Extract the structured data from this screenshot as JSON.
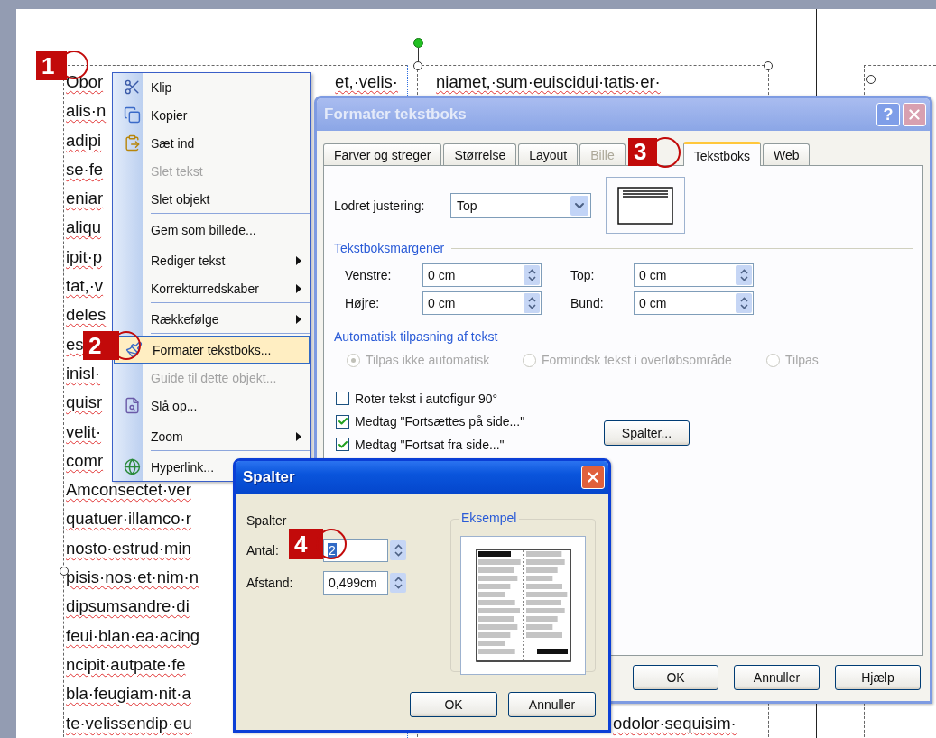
{
  "document": {
    "left_lines": [
      "Obor",
      "alis·n",
      "adipi",
      "se·fe",
      "eniar",
      "aliqu",
      "ipit·p",
      "tat,·v",
      "deles",
      "es",
      "inisl·",
      "quisr",
      "velit·",
      "comr",
      "Amconsectet·ver",
      "quatuer·illamco·r",
      "nosto·estrud·min",
      "pisis·nos·et·nim·n",
      "dipsumsandre·di",
      "feui·blan·ea·acing",
      "ncipit·autpate·fe",
      "bla·feugiam·nit·a",
      "te·velissendip·eu"
    ],
    "first_line_end": "et,·velis·",
    "right_first_line": "niamet,·sum·euiscidui·tatis·er·",
    "right_last_line": "odolor·sequisim·"
  },
  "context_menu": {
    "items": [
      {
        "kind": "command",
        "label": "Klip",
        "selected": false,
        "disabled": false
      },
      {
        "kind": "command",
        "label": "Kopier",
        "selected": false,
        "disabled": false
      },
      {
        "kind": "command",
        "label": "Sæt ind",
        "selected": false,
        "disabled": false
      },
      {
        "kind": "command",
        "label": "Slet tekst",
        "selected": false,
        "disabled": true
      },
      {
        "kind": "command",
        "label": "Slet objekt",
        "selected": false,
        "disabled": false
      },
      {
        "kind": "separator"
      },
      {
        "kind": "command",
        "label": "Gem som billede...",
        "selected": false,
        "disabled": false
      },
      {
        "kind": "separator"
      },
      {
        "kind": "submenu",
        "label": "Rediger tekst",
        "selected": false,
        "disabled": false
      },
      {
        "kind": "submenu",
        "label": "Korrekturredskaber",
        "selected": false,
        "disabled": false
      },
      {
        "kind": "separator"
      },
      {
        "kind": "submenu",
        "label": "Rækkefølge",
        "selected": false,
        "disabled": false
      },
      {
        "kind": "separator"
      },
      {
        "kind": "command",
        "label": "Formater tekstboks...",
        "selected": true,
        "disabled": false
      },
      {
        "kind": "command",
        "label": "Guide til dette objekt...",
        "selected": false,
        "disabled": true
      },
      {
        "kind": "command",
        "label": "Slå op...",
        "selected": false,
        "disabled": false
      },
      {
        "kind": "separator"
      },
      {
        "kind": "submenu",
        "label": "Zoom",
        "selected": false,
        "disabled": false
      },
      {
        "kind": "separator"
      },
      {
        "kind": "command",
        "label": "Hyperlink...",
        "selected": false,
        "disabled": false
      }
    ]
  },
  "format_dialog": {
    "title": "Formater tekstboks",
    "help_button": "?",
    "tabs": [
      {
        "label": "Farver og streger",
        "selected": false,
        "disabled": false
      },
      {
        "label": "Størrelse",
        "selected": false,
        "disabled": false
      },
      {
        "label": "Layout",
        "selected": false,
        "disabled": false
      },
      {
        "label": "Bille",
        "selected": false,
        "disabled": true
      },
      {
        "label": "Tekstboks",
        "selected": true,
        "disabled": false
      },
      {
        "label": "Web",
        "selected": false,
        "disabled": false
      }
    ],
    "vertical_alignment": {
      "label": "Lodret justering:",
      "value": "Top"
    },
    "margins": {
      "title": "Tekstboksmargener",
      "fields": [
        {
          "label": "Venstre:",
          "value": "0 cm"
        },
        {
          "label": "Top:",
          "value": "0 cm"
        },
        {
          "label": "Højre:",
          "value": "0 cm"
        },
        {
          "label": "Bund:",
          "value": "0 cm"
        }
      ]
    },
    "autofit": {
      "title": "Automatisk tilpasning af tekst",
      "options": [
        {
          "label": "Tilpas ikke automatisk",
          "selected": true,
          "disabled": true
        },
        {
          "label": "Formindsk tekst i overløbsområde",
          "selected": false,
          "disabled": true
        },
        {
          "label": "Tilpas",
          "selected": false,
          "disabled": true
        }
      ]
    },
    "checkboxes": [
      {
        "label": "Roter tekst i autofigur 90°",
        "checked": false
      },
      {
        "label": "Medtag \"Fortsættes på side...\"",
        "checked": true
      },
      {
        "label": "Medtag \"Fortsat fra side...\"",
        "checked": true
      }
    ],
    "columns_button": "Spalter...",
    "buttons": [
      "OK",
      "Annuller",
      "Hjælp"
    ]
  },
  "columns_dialog": {
    "title": "Spalter",
    "section": "Spalter",
    "fields": [
      {
        "label": "Antal:",
        "value": "2",
        "selected": true
      },
      {
        "label": "Afstand:",
        "value": "0,499cm",
        "selected": false
      }
    ],
    "preview_title": "Eksempel",
    "buttons": [
      "OK",
      "Annuller"
    ]
  },
  "callouts": [
    {
      "label": "1"
    },
    {
      "label": "2"
    },
    {
      "label": "3"
    },
    {
      "label": "4"
    }
  ]
}
